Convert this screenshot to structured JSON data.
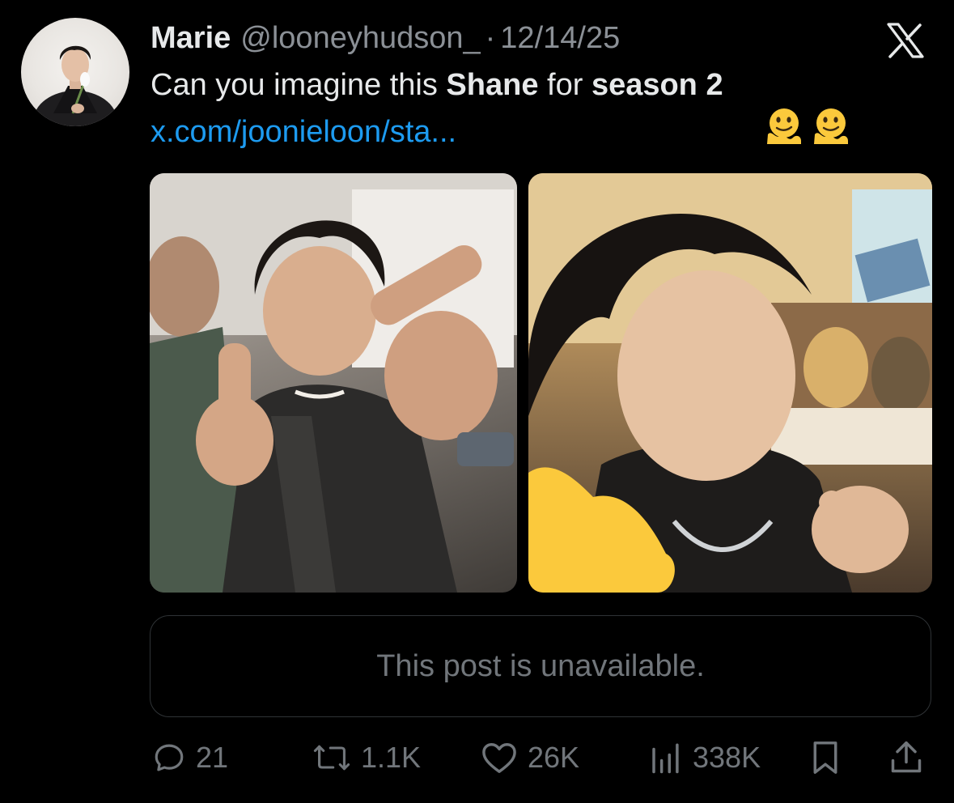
{
  "tweet": {
    "author_name": "Marie",
    "author_handle": "@looneyhudson_",
    "separator": "·",
    "date": "12/14/25",
    "text_part1": "Can you imagine this ",
    "text_bold1": "Shane",
    "text_part2": " for ",
    "text_bold2": "season 2",
    "emojis": [
      "melting-face-emoji",
      "melting-face-emoji"
    ],
    "link": "x.com/joonieloon/sta..."
  },
  "media": {
    "count": 2,
    "items": [
      {
        "icon": "photo-image"
      },
      {
        "icon": "photo-image"
      }
    ]
  },
  "quote": {
    "message": "This post is unavailable."
  },
  "actions": {
    "replies": "21",
    "reposts": "1.1K",
    "likes": "26K",
    "views": "338K"
  },
  "colors": {
    "background": "#000000",
    "text": "#e7e9ea",
    "secondary": "#71767b",
    "link": "#1d9bf0",
    "border": "#2f3336"
  }
}
